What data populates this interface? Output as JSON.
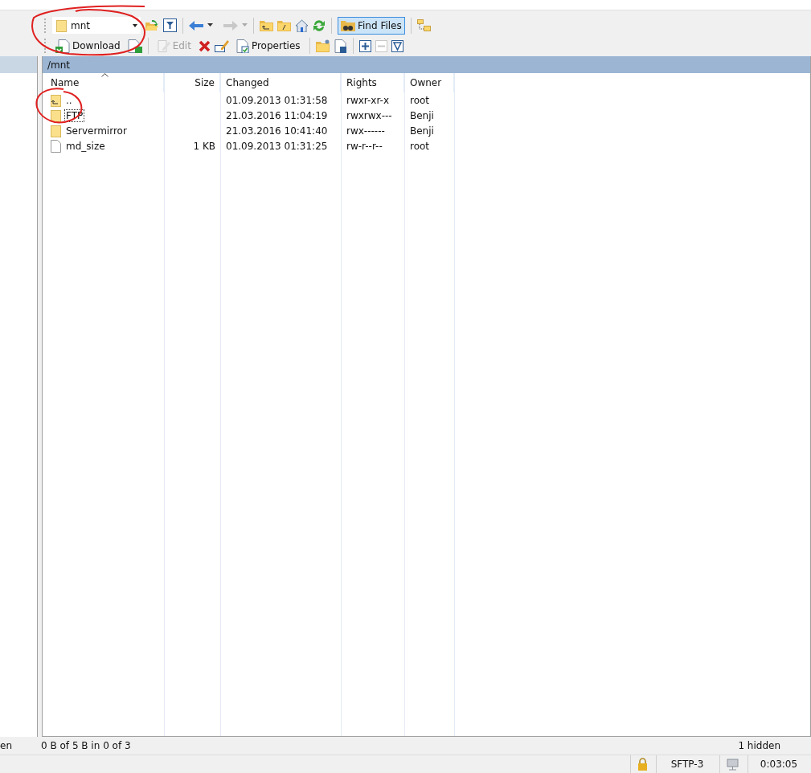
{
  "toolbar_top": {
    "location": {
      "value": "mnt"
    },
    "find_files": {
      "label": "Find Files",
      "pressed": true
    },
    "back": {
      "disabled": false
    },
    "forward": {
      "disabled": true
    }
  },
  "toolbar_bottom": {
    "download": {
      "label": "Download",
      "disabled": false
    },
    "edit": {
      "label": "Edit",
      "disabled": true
    },
    "properties": {
      "label": "Properties",
      "disabled": false
    },
    "collapse": {
      "disabled": true
    }
  },
  "path_bar": {
    "path": "/mnt"
  },
  "table": {
    "columns": [
      {
        "label": "Name",
        "sorted": true
      },
      {
        "label": "Size",
        "sorted": false
      },
      {
        "label": "Changed",
        "sorted": false
      },
      {
        "label": "Rights",
        "sorted": false
      },
      {
        "label": "Owner",
        "sorted": false
      }
    ],
    "rows": [
      {
        "kind": "parent",
        "name": "..",
        "size": "",
        "changed": "01.09.2013 01:31:58",
        "rights": "rwxr-xr-x",
        "owner": "root",
        "focused": false
      },
      {
        "kind": "folder",
        "name": "FTP",
        "size": "",
        "changed": "21.03.2016 11:04:19",
        "rights": "rwxrwx---",
        "owner": "Benji",
        "focused": true
      },
      {
        "kind": "folder",
        "name": "Servermirror",
        "size": "",
        "changed": "21.03.2016 10:41:40",
        "rights": "rwx------",
        "owner": "Benji",
        "focused": false
      },
      {
        "kind": "file",
        "name": "md_size",
        "size": "1 KB",
        "changed": "01.09.2013 01:31:25",
        "rights": "rw-r--r--",
        "owner": "root",
        "focused": false
      }
    ]
  },
  "status_bar": {
    "left_panel": "en",
    "selection": "0 B of 5 B in 0 of 3",
    "hidden": "1 hidden"
  },
  "session_bar": {
    "protocol": "SFTP-3",
    "elapsed": "0:03:05"
  }
}
